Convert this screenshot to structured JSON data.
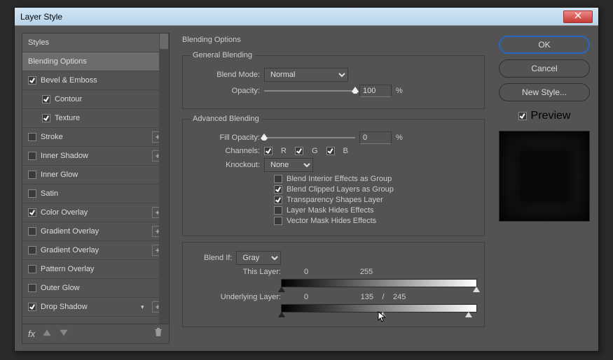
{
  "window": {
    "title": "Layer Style"
  },
  "styles_header": "Styles",
  "styles": [
    {
      "label": "Blending Options",
      "checked": null,
      "selected": true,
      "indent": false,
      "plus": false,
      "chev": false
    },
    {
      "label": "Bevel & Emboss",
      "checked": true,
      "indent": false,
      "plus": false,
      "chev": false
    },
    {
      "label": "Contour",
      "checked": true,
      "indent": true,
      "plus": false,
      "chev": false
    },
    {
      "label": "Texture",
      "checked": true,
      "indent": true,
      "plus": false,
      "chev": false
    },
    {
      "label": "Stroke",
      "checked": false,
      "indent": false,
      "plus": true,
      "chev": false
    },
    {
      "label": "Inner Shadow",
      "checked": false,
      "indent": false,
      "plus": true,
      "chev": false
    },
    {
      "label": "Inner Glow",
      "checked": false,
      "indent": false,
      "plus": false,
      "chev": false
    },
    {
      "label": "Satin",
      "checked": false,
      "indent": false,
      "plus": false,
      "chev": false
    },
    {
      "label": "Color Overlay",
      "checked": true,
      "indent": false,
      "plus": true,
      "chev": false
    },
    {
      "label": "Gradient Overlay",
      "checked": false,
      "indent": false,
      "plus": true,
      "chev": false
    },
    {
      "label": "Gradient Overlay",
      "checked": false,
      "indent": false,
      "plus": true,
      "chev": false
    },
    {
      "label": "Pattern Overlay",
      "checked": false,
      "indent": false,
      "plus": false,
      "chev": false
    },
    {
      "label": "Outer Glow",
      "checked": false,
      "indent": false,
      "plus": false,
      "chev": false
    },
    {
      "label": "Drop Shadow",
      "checked": true,
      "indent": false,
      "plus": true,
      "chev": true
    }
  ],
  "fx_label": "fx",
  "settings": {
    "title": "Blending Options",
    "general": {
      "legend": "General Blending",
      "blend_mode_label": "Blend Mode:",
      "blend_mode_value": "Normal",
      "opacity_label": "Opacity:",
      "opacity_value": "100",
      "opacity_pct": 100,
      "percent": "%"
    },
    "advanced": {
      "legend": "Advanced Blending",
      "fill_opacity_label": "Fill Opacity:",
      "fill_opacity_value": "0",
      "fill_opacity_pct": 0,
      "percent": "%",
      "channels_label": "Channels:",
      "channel_r": "R",
      "channel_g": "G",
      "channel_b": "B",
      "channel_r_checked": true,
      "channel_g_checked": true,
      "channel_b_checked": true,
      "knockout_label": "Knockout:",
      "knockout_value": "None",
      "opt1": {
        "label": "Blend Interior Effects as Group",
        "checked": false
      },
      "opt2": {
        "label": "Blend Clipped Layers as Group",
        "checked": true
      },
      "opt3": {
        "label": "Transparency Shapes Layer",
        "checked": true
      },
      "opt4": {
        "label": "Layer Mask Hides Effects",
        "checked": false
      },
      "opt5": {
        "label": "Vector Mask Hides Effects",
        "checked": false
      }
    },
    "blendif": {
      "label": "Blend If:",
      "value": "Gray",
      "this_layer_label": "This Layer:",
      "this_low": "0",
      "this_high": "255",
      "underlying_label": "Underlying Layer:",
      "under_low": "0",
      "under_mid": "135",
      "under_slash": "/",
      "under_high": "245",
      "under_split_pct": 52,
      "under_white_pct": 96
    }
  },
  "right": {
    "ok": "OK",
    "cancel": "Cancel",
    "new_style": "New Style...",
    "preview": "Preview",
    "preview_checked": true
  }
}
